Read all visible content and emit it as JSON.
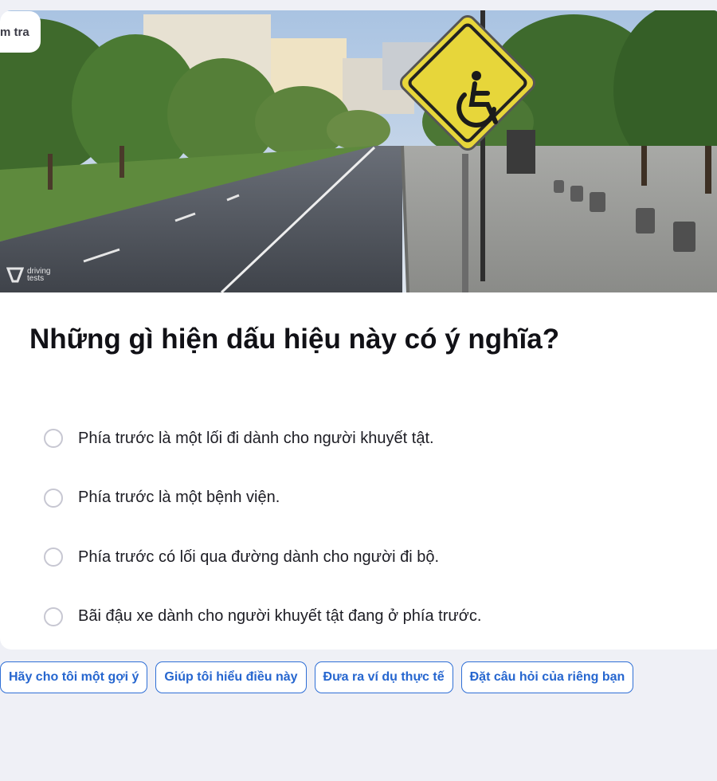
{
  "hero": {
    "badge_label": "m tra",
    "logo_line1": "driving",
    "logo_line2": "tests",
    "sign_icon": "wheelchair-icon"
  },
  "question": {
    "text": "Những gì hiện dấu hiệu này có ý nghĩa?",
    "options": [
      {
        "label": "Phía trước là một lối đi dành cho người khuyết tật."
      },
      {
        "label": "Phía trước là một bệnh viện."
      },
      {
        "label": "Phía trước có lối qua đường dành cho người đi bộ."
      },
      {
        "label": "Bãi đậu xe dành cho người khuyết tật đang ở phía trước."
      }
    ]
  },
  "actions": {
    "hint": "Hãy cho tôi một gợi ý",
    "explain": "Giúp tôi hiểu điều này",
    "example": "Đưa ra ví dụ thực tế",
    "ask": "Đặt câu hỏi của riêng bạn"
  },
  "colors": {
    "page_bg": "#eff0f6",
    "accent": "#2666cf",
    "sign_yellow": "#e7d63a"
  }
}
